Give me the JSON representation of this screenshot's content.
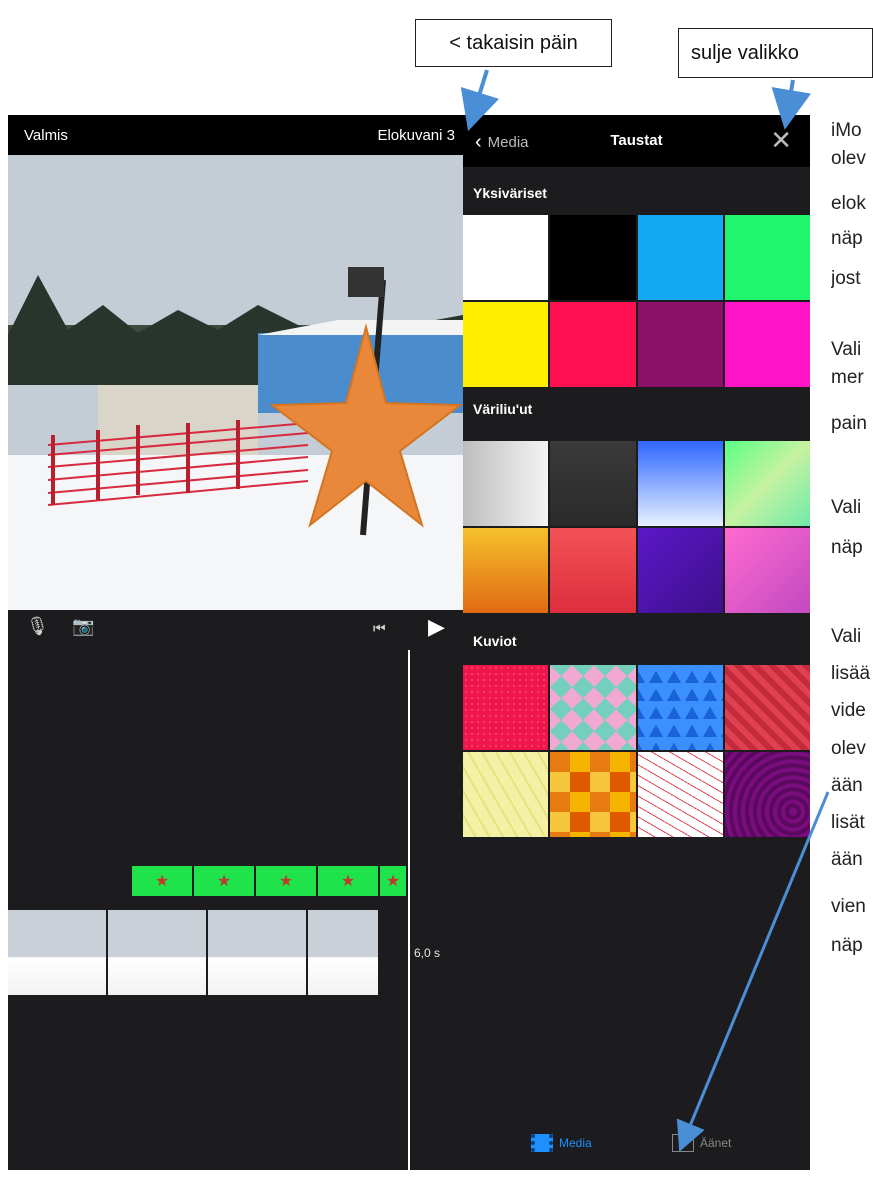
{
  "callouts": {
    "back": "< takaisin päin",
    "close": "sulje valikko"
  },
  "notes": [
    "iMo",
    "olev",
    "elok",
    "näp",
    "jost",
    "Vali",
    "mer",
    "pain",
    "Vali",
    "näp",
    "Vali",
    "lisää",
    "vide",
    "olev",
    "ään",
    "lisät",
    "ään",
    "vien",
    "näp"
  ],
  "left": {
    "done_label": "Valmis",
    "project_title": "Elokuvani 3",
    "duration": "6,0 s"
  },
  "right": {
    "back_label": "Media",
    "title": "Taustat",
    "sections": [
      {
        "title": "Yksiväriset",
        "swatches": [
          "#ffffff",
          "#000000",
          "#12a8f2",
          "#1ff56d",
          "#ffee00",
          "#ff1050",
          "#8a1068",
          "#ff14c8"
        ]
      },
      {
        "title": "Väriliu'ut",
        "swatches": [
          "linear-gradient(90deg,#bdbdbd,#f4f4f4)",
          "linear-gradient(180deg,#3a3a3a,#2a2a2a)",
          "linear-gradient(180deg,#2e66ff,#e7f1ff)",
          "linear-gradient(135deg,#5aff84,#c6f2a1,#6eeaa8)",
          "linear-gradient(180deg,#f6c12a,#e06a12)",
          "linear-gradient(180deg,#f25255,#dd2e3d)",
          "linear-gradient(135deg,#5a18c8,#3e0f8a)",
          "linear-gradient(135deg,#ff6ad0,#c24ac0)"
        ]
      },
      {
        "title": "Kuviot",
        "swatches": [
          "#f0164c",
          "#7fd6c4",
          "#2a7ef2",
          "#d63a46",
          "#f2f0a2",
          "#f6a019",
          "#ffffff",
          "#7a0c7e"
        ]
      }
    ],
    "tabs": {
      "media": "Media",
      "audio": "Äänet"
    }
  }
}
